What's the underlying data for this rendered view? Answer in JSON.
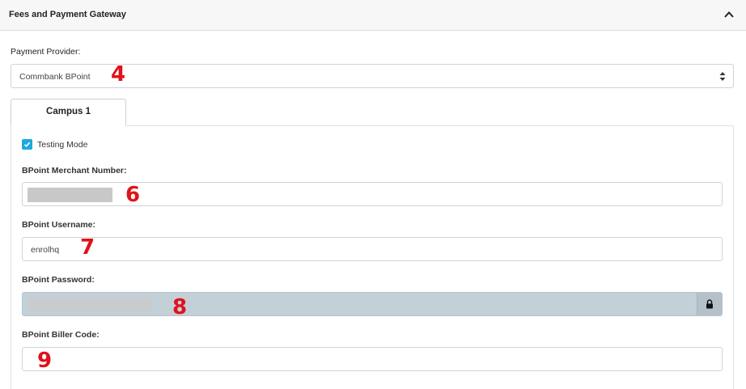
{
  "panel": {
    "title": "Fees and Payment Gateway"
  },
  "provider": {
    "label": "Payment Provider:",
    "value": "Commbank BPoint"
  },
  "tabs": [
    {
      "label": "Campus 1"
    }
  ],
  "testing_mode": {
    "label": "Testing Mode",
    "checked": true
  },
  "fields": {
    "merchant_number": {
      "label": "BPoint Merchant Number:",
      "value": ""
    },
    "username": {
      "label": "BPoint Username:",
      "value": "enrolhq"
    },
    "password": {
      "label": "BPoint Password:",
      "value": ""
    },
    "biller_code": {
      "label": "BPoint Biller Code:",
      "value": ""
    }
  },
  "annotations": [
    "4",
    "6",
    "7",
    "8",
    "9"
  ],
  "icons": {
    "collapse": "chevron-up-icon",
    "select": "select-arrows-icon",
    "lock": "lock-icon",
    "check": "check-icon"
  },
  "colors": {
    "checkbox": "#1ea7e1",
    "disabled_field": "#c4d0d8",
    "annotation": "#e0121c"
  }
}
